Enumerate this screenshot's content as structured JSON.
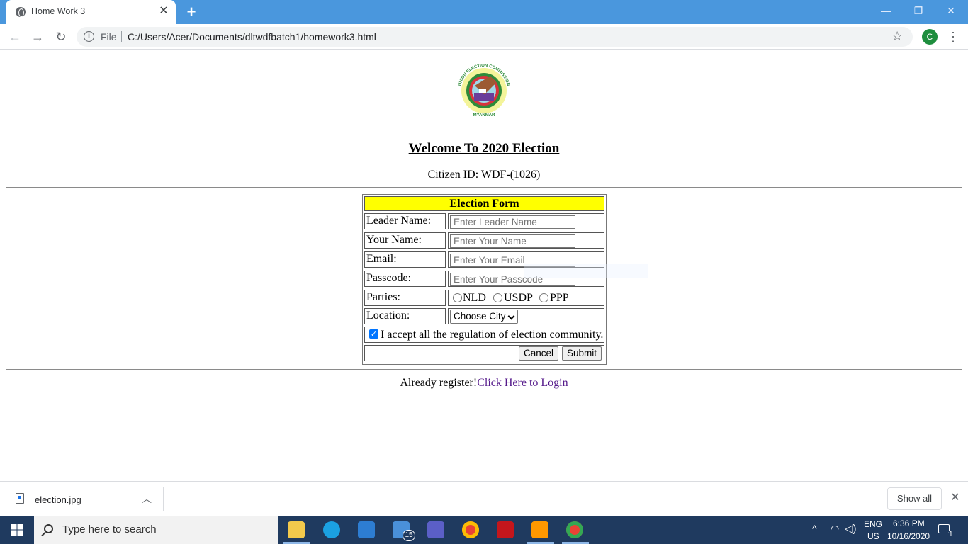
{
  "browser": {
    "tab_title": "Home Work 3",
    "scheme_label": "File",
    "url": "C:/Users/Acer/Documents/dltwdfbatch1/homework3.html",
    "profile_initial": "C"
  },
  "page": {
    "logo": {
      "top_text": "UNION ELECTION COMMISSION",
      "bottom_text": "MYANMAR"
    },
    "welcome": "Welcome To 2020 Election",
    "citizen_id": "Citizen ID: WDF-(1026)",
    "form": {
      "title": "Election Form",
      "leader_label": "Leader Name:",
      "leader_placeholder": "Enter Leader Name",
      "name_label": "Your Name:",
      "name_placeholder": "Enter Your Name",
      "email_label": "Email:",
      "email_placeholder": "Enter Your Email",
      "passcode_label": "Passcode:",
      "passcode_placeholder": "Enter Your Passcode",
      "parties_label": "Parties:",
      "parties": [
        "NLD",
        "USDP",
        "PPP"
      ],
      "location_label": "Location:",
      "location_select": "Choose City",
      "accept_checked": true,
      "accept_text": "I accept all the regulation of election community.",
      "cancel_label": "Cancel",
      "submit_label": "Submit"
    },
    "login_prefix": "Already register!",
    "login_link": "Click Here to Login"
  },
  "download_shelf": {
    "file_name": "election.jpg",
    "show_all": "Show all"
  },
  "taskbar": {
    "search_placeholder": "Type here to search",
    "mail_badge": "15",
    "language": "ENG",
    "region": "US",
    "time": "6:36 PM",
    "date": "10/16/2020",
    "notification_count": "1"
  },
  "colors": {
    "tabbar": "#4a97dd",
    "form_title_bg": "#ffff00",
    "link": "#551a8b",
    "taskbar": "#1f3a5f"
  }
}
